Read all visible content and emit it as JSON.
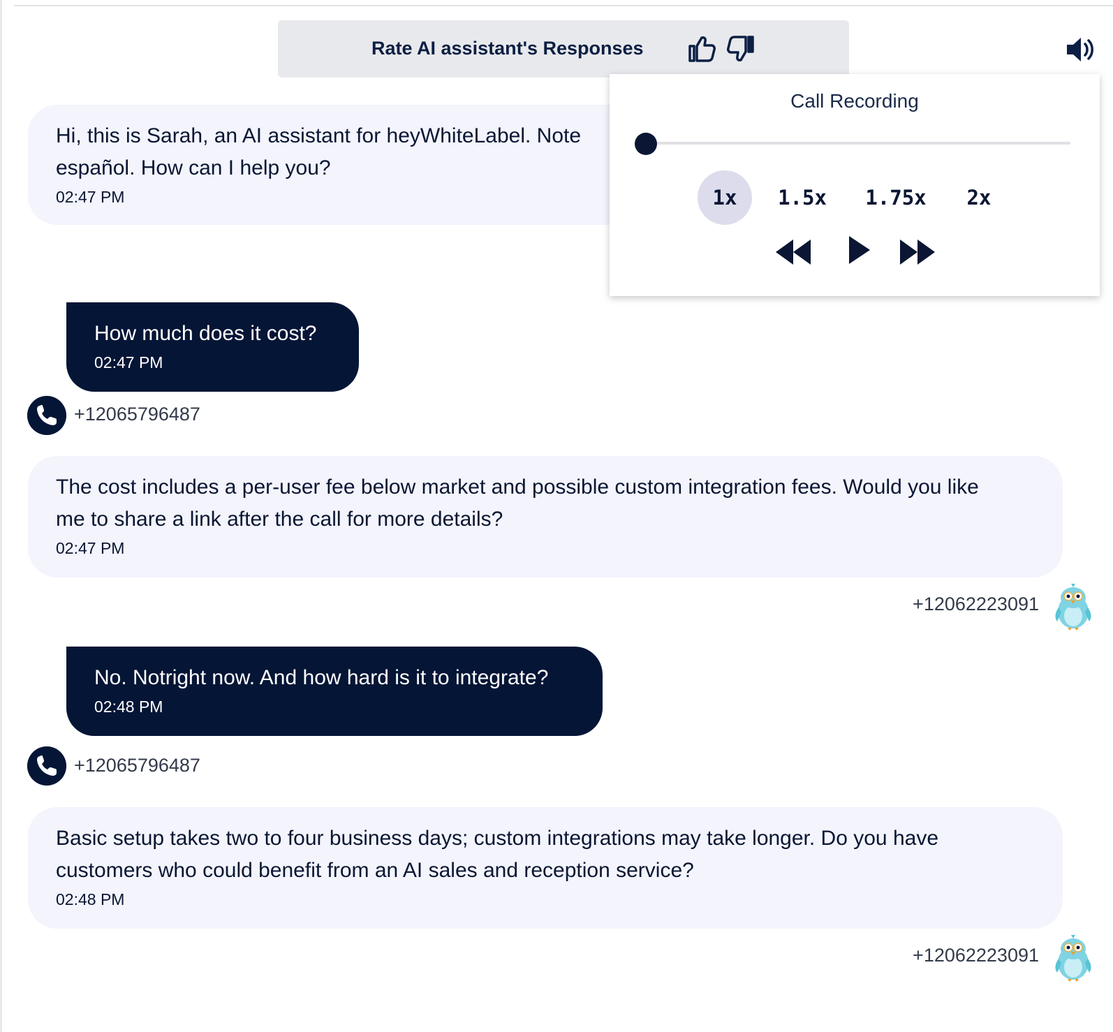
{
  "rating": {
    "title": "Rate AI assistant's Responses",
    "thumbs_up_icon": "thumbs-up-icon",
    "thumbs_down_icon": "thumbs-down-icon"
  },
  "volume_icon": "speaker-volume-icon",
  "recording_panel": {
    "title": "Call Recording",
    "playback_progress": 0,
    "speeds": [
      "1x",
      "1.5x",
      "1.75x",
      "2x"
    ],
    "selected_speed": "1x",
    "controls": [
      "rewind-icon",
      "play-icon",
      "fast-forward-icon"
    ]
  },
  "colors": {
    "dark_navy": "#051536",
    "ai_bubble": "#f3f4fc",
    "rate_bar": "#e8e9ec",
    "speed_active": "#dcdcec"
  },
  "messages": [
    {
      "role": "assistant",
      "text_line1": "Hi, this is Sarah, an AI assistant for heyWhiteLabel. Note",
      "text_line2": "español. How can I help you?",
      "time": "02:47 PM"
    },
    {
      "role": "caller",
      "text": "How much does it cost?",
      "time": "02:47 PM",
      "number": "+12065796487"
    },
    {
      "role": "assistant",
      "text_line1": "The cost includes a per-user fee below market and possible custom integration fees. Would you like",
      "text_line2": "me to share a link after the call for more details?",
      "time": "02:47 PM",
      "number": "+12062223091"
    },
    {
      "role": "caller",
      "text": "No. Notright now. And how hard is it to integrate?",
      "time": "02:48 PM",
      "number": "+12065796487"
    },
    {
      "role": "assistant",
      "text_line1": "Basic setup takes two to four business days; custom integrations may take longer. Do you have",
      "text_line2": "customers who could benefit from an AI sales and reception service?",
      "time": "02:48 PM",
      "number": "+12062223091"
    }
  ]
}
